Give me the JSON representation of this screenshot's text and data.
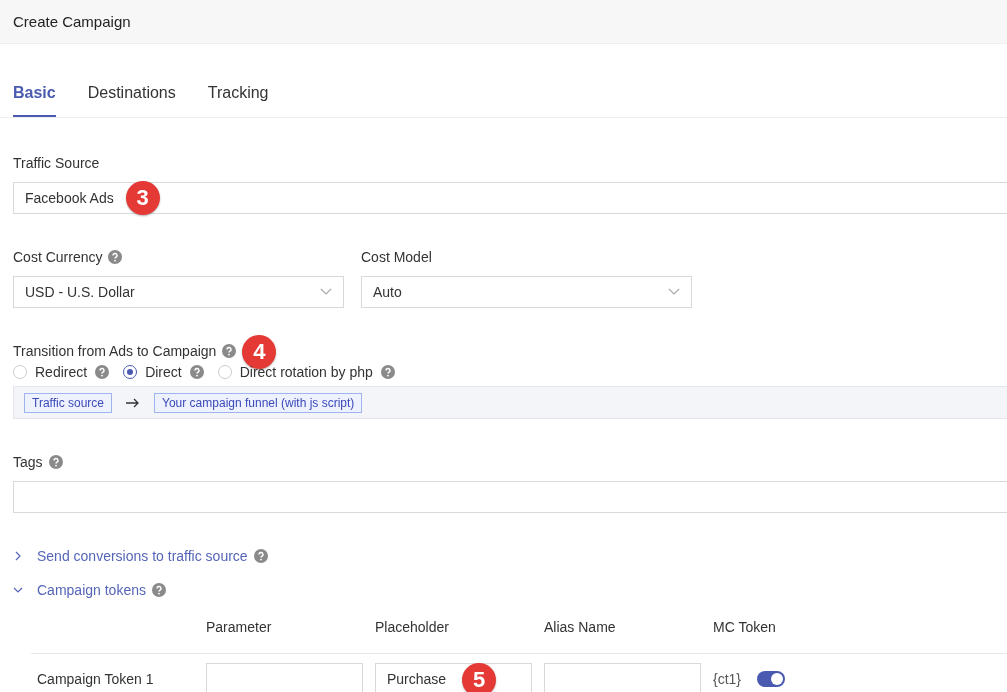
{
  "window": {
    "title": "Create Campaign"
  },
  "tabs": [
    {
      "label": "Basic",
      "selected": true
    },
    {
      "label": "Destinations",
      "selected": false
    },
    {
      "label": "Tracking",
      "selected": false
    }
  ],
  "traffic_source": {
    "label": "Traffic Source",
    "value": "Facebook Ads",
    "marker": "3"
  },
  "cost_currency": {
    "label": "Cost Currency",
    "value": "USD - U.S. Dollar"
  },
  "cost_model": {
    "label": "Cost Model",
    "value": "Auto"
  },
  "transition": {
    "label": "Transition from Ads to Campaign",
    "marker": "4",
    "options": [
      {
        "label": "Redirect",
        "selected": false
      },
      {
        "label": "Direct",
        "selected": true
      },
      {
        "label": "Direct rotation by php",
        "selected": false
      }
    ],
    "flow": [
      "Traffic source",
      "Your campaign funnel (with js script)"
    ]
  },
  "tags": {
    "label": "Tags"
  },
  "sections": [
    {
      "label": "Send conversions to traffic source",
      "expanded": false
    },
    {
      "label": "Campaign tokens",
      "expanded": true
    }
  ],
  "tokens": {
    "columns": [
      "Parameter",
      "Placeholder",
      "Alias Name",
      "MC Token"
    ],
    "rows": [
      {
        "name": "Campaign Token 1",
        "placeholder": "Purchase",
        "placeholder_marker": "5",
        "mc_token": "{ct1}",
        "on": true
      }
    ]
  }
}
